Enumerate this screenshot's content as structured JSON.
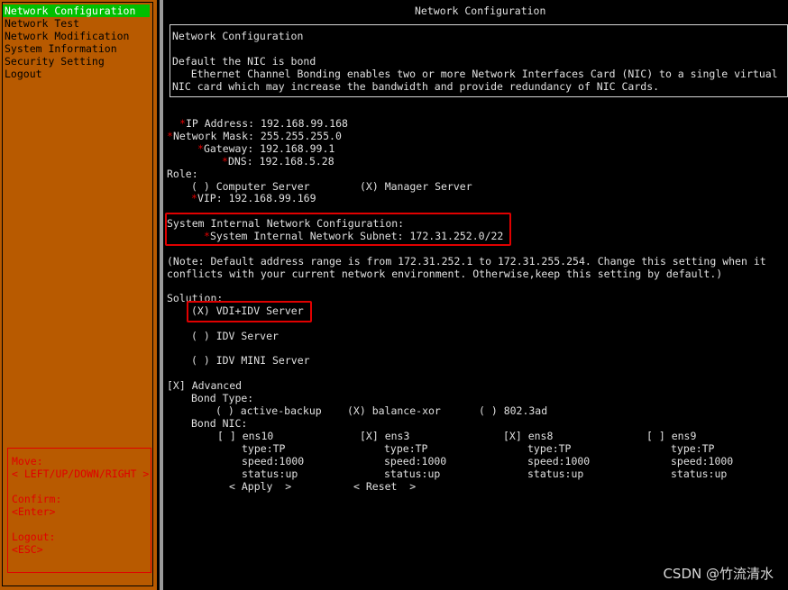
{
  "left_menu": {
    "items": [
      {
        "label": "Network Configuration",
        "active": true
      },
      {
        "label": "Network Test",
        "active": false
      },
      {
        "label": "Network Modification",
        "active": false
      },
      {
        "label": "System Information",
        "active": false
      },
      {
        "label": "Security Setting",
        "active": false
      },
      {
        "label": "Logout",
        "active": false
      }
    ],
    "help": {
      "move_label": "Move:",
      "move_keys": "< LEFT/UP/DOWN/RIGHT >",
      "confirm_label": "Confirm:",
      "confirm_key": "<Enter>",
      "logout_label": "Logout:",
      "logout_key": "<ESC>"
    }
  },
  "panel": {
    "title": "Network Configuration",
    "info": {
      "heading": "Network Configuration",
      "line1": "Default the NIC is bond",
      "line2": "   Ethernet Channel Bonding enables two or more Network Interfaces Card (NIC) to a single virtual",
      "line3": "NIC card which may increase the bandwidth and provide redundancy of NIC Cards."
    },
    "fields": {
      "ip_label": "IP Address: ",
      "ip_value": "192.168.99.168",
      "mask_label": "Network Mask: ",
      "mask_value": "255.255.255.0",
      "gateway_label": "Gateway: ",
      "gateway_value": "192.168.99.1",
      "dns_label": "DNS: ",
      "dns_value": "192.168.5.28"
    },
    "role": {
      "label": "Role:",
      "option1": "( ) Computer Server",
      "option2": "(X) Manager Server",
      "vip_label": "VIP: ",
      "vip_value": "192.168.99.169"
    },
    "internal": {
      "heading": "System Internal Network Configuration:",
      "subnet_label": "System Internal Network Subnet: ",
      "subnet_value": "172.31.252.0/22"
    },
    "note": {
      "line1": "(Note: Default address range is from 172.31.252.1 to 172.31.255.254. Change this setting when it",
      "line2": "conflicts with your current network environment. Otherwise,keep this setting by default.)"
    },
    "solution": {
      "label": "Solution:",
      "option1": "(X) VDI+IDV Server",
      "option2": "( ) IDV Server",
      "option3": "( ) IDV MINI Server"
    },
    "advanced": {
      "label": "[X] Advanced",
      "bond_type_label": "Bond Type:",
      "bond_type_options": [
        "( ) active-backup",
        "(X) balance-xor",
        "( ) 802.3ad"
      ],
      "bond_nic_label": "Bond NIC:",
      "nics": [
        {
          "check": "[ ] ens10",
          "type": "type:TP",
          "speed": "speed:1000",
          "status": "status:up"
        },
        {
          "check": "[X] ens3",
          "type": "type:TP",
          "speed": "speed:1000",
          "status": "status:up"
        },
        {
          "check": "[X] ens8",
          "type": "type:TP",
          "speed": "speed:1000",
          "status": "status:up"
        },
        {
          "check": "[ ] ens9",
          "type": "type:TP",
          "speed": "speed:1000",
          "status": "status:up"
        }
      ]
    },
    "buttons": {
      "apply": "< Apply  >",
      "reset": "< Reset  >"
    }
  },
  "watermark": "CSDN @竹流清水",
  "colors": {
    "menu_bg": "#b85a00",
    "active_item": "#00c000",
    "required_star": "#e00000",
    "highlight_box": "#e00000"
  }
}
